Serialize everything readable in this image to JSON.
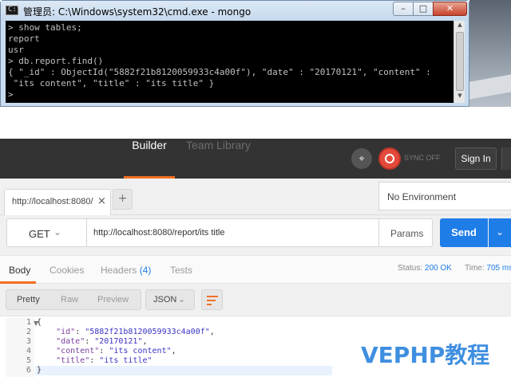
{
  "cmd": {
    "title": "管理员: C:\\Windows\\system32\\cmd.exe - mongo",
    "lines": [
      "> show tables;",
      "report",
      "usr",
      "> db.report.find()",
      "{ \"_id\" : ObjectId(\"5882f21b8120059933c4a00f\"), \"date\" : \"20170121\", \"content\" :",
      " \"its content\", \"title\" : \"its title\" }",
      ">"
    ]
  },
  "postman": {
    "header": {
      "builder_tab": "Builder",
      "team_tab": "Team Library",
      "sync_status": "SYNC OFF",
      "sign_in": "Sign In"
    },
    "tabs": {
      "active_tab": "http://localhost:8080/",
      "close": "×",
      "new_tab": "+",
      "environment": "No Environment"
    },
    "request": {
      "method": "GET",
      "url": "http://localhost:8080/report/its title",
      "params": "Params",
      "send": "Send"
    },
    "response": {
      "tabs": {
        "body": "Body",
        "cookies": "Cookies",
        "headers": "Headers",
        "headers_count": "(4)",
        "tests": "Tests"
      },
      "status_label": "Status:",
      "status_value": "200 OK",
      "time_label": "Time:",
      "time_value": "705 ms",
      "view": {
        "pretty": "Pretty",
        "raw": "Raw",
        "preview": "Preview",
        "format": "JSON"
      },
      "body_lines": [
        {
          "n": "1",
          "pre": "{",
          "key": "",
          "sep": "",
          "val": "",
          "post": ""
        },
        {
          "n": "2",
          "pre": "    ",
          "key": "\"id\"",
          "sep": ": ",
          "val": "\"5882f21b8120059933c4a00f\"",
          "post": ","
        },
        {
          "n": "3",
          "pre": "    ",
          "key": "\"date\"",
          "sep": ": ",
          "val": "\"20170121\"",
          "post": ","
        },
        {
          "n": "4",
          "pre": "    ",
          "key": "\"content\"",
          "sep": ": ",
          "val": "\"its content\"",
          "post": ","
        },
        {
          "n": "5",
          "pre": "    ",
          "key": "\"title\"",
          "sep": ": ",
          "val": "\"its title\"",
          "post": ""
        },
        {
          "n": "6",
          "pre": "}",
          "key": "",
          "sep": "",
          "val": "",
          "post": ""
        }
      ]
    }
  },
  "watermark": "VEPHP教程",
  "colors": {
    "accent": "#f47023",
    "primary": "#1f7de8",
    "header_bg": "#333333",
    "sync_red": "#e34a3b"
  },
  "icons": {
    "satellite": "satellite-icon",
    "sync": "sync-icon",
    "wrap": "wrap-lines-icon"
  }
}
